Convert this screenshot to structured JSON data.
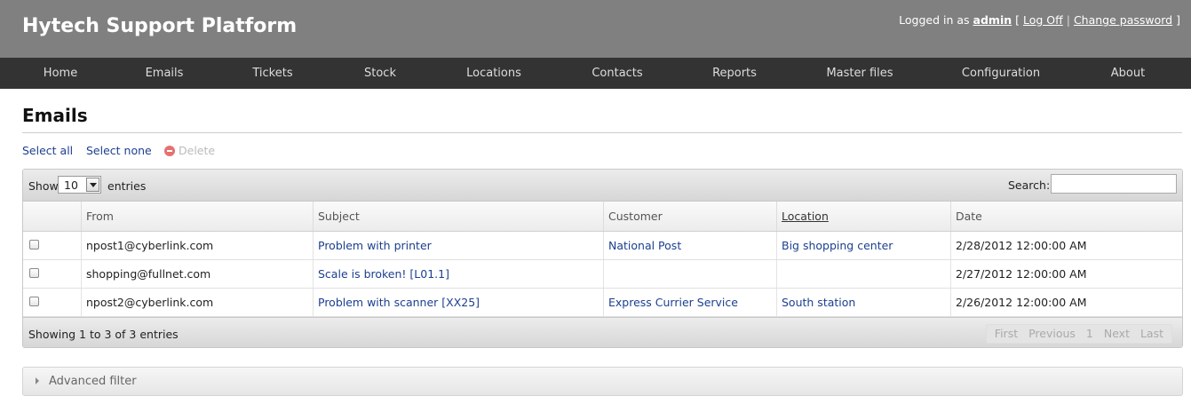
{
  "app": {
    "title": "Hytech Support Platform",
    "login": {
      "prefix": "Logged in as",
      "user": "admin",
      "bracket_open": "[",
      "logoff": "Log Off",
      "separator": "|",
      "change_password": "Change password",
      "bracket_close": "]"
    }
  },
  "nav": {
    "items": [
      "Home",
      "Emails",
      "Tickets",
      "Stock",
      "Locations",
      "Contacts",
      "Reports",
      "Master files",
      "Configuration",
      "About"
    ]
  },
  "page": {
    "title": "Emails",
    "actions": {
      "select_all": "Select all",
      "select_none": "Select none",
      "delete": "Delete"
    }
  },
  "table": {
    "show_label": "Show",
    "page_length": "10",
    "entries_label": "entries",
    "search_label": "Search:",
    "search_value": "",
    "columns": [
      "From",
      "Subject",
      "Customer",
      "Location",
      "Date"
    ],
    "rows": [
      {
        "from": "npost1@cyberlink.com",
        "subject": "Problem with printer",
        "customer": "National Post",
        "location": "Big shopping center",
        "date": "2/28/2012 12:00:00 AM"
      },
      {
        "from": "shopping@fullnet.com",
        "subject": "Scale is broken! [L01.1]",
        "customer": "",
        "location": "",
        "date": "2/27/2012 12:00:00 AM"
      },
      {
        "from": "npost2@cyberlink.com",
        "subject": "Problem with scanner [XX25]",
        "customer": "Express Currier Service",
        "location": "South station",
        "date": "2/26/2012 12:00:00 AM"
      }
    ],
    "info": "Showing 1 to 3 of 3 entries",
    "pager": {
      "first": "First",
      "previous": "Previous",
      "page": "1",
      "next": "Next",
      "last": "Last"
    }
  },
  "advanced_filter": {
    "label": "Advanced filter"
  },
  "colors": {
    "header_bg": "#808080",
    "nav_bg": "#333333",
    "link": "#1c3f8f"
  }
}
